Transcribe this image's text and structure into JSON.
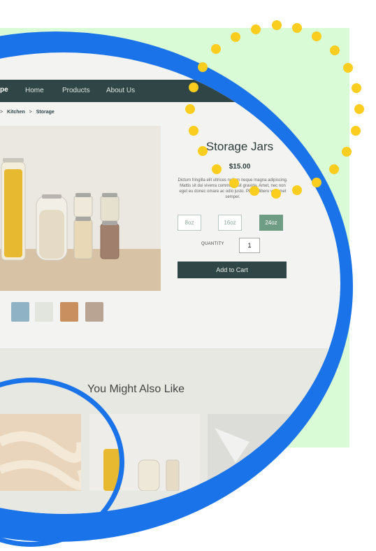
{
  "nav": {
    "brand": "pe",
    "links": [
      "Home",
      "Products",
      "About Us"
    ]
  },
  "breadcrumb": [
    "Kitchen",
    "Storage"
  ],
  "breadcrumb_sep": ">",
  "product": {
    "title": "Storage Jars",
    "price": "$15.00",
    "description": "Dictum fringilla elit ultrices nullam neque magna adipiscing. Mattis sit dui viverra commodo sit gravida. Amet, nec non eget eu donec omare ac odio justo. Platea libero vel amet semper.",
    "sizes": [
      "8oz",
      "16oz",
      "24oz"
    ],
    "selected_size": "24oz",
    "quantity_label": "QUANTITY",
    "quantity": "1",
    "add_to_cart": "Add to Cart"
  },
  "recommendations": {
    "heading": "You Might Also Like"
  },
  "colors": {
    "accent_blue": "#1a73e8",
    "dot_yellow": "#fbcd1f",
    "nav_dark": "#2f4546",
    "selected_green": "#6f9c84",
    "backdrop_green": "#d9fbd6"
  }
}
